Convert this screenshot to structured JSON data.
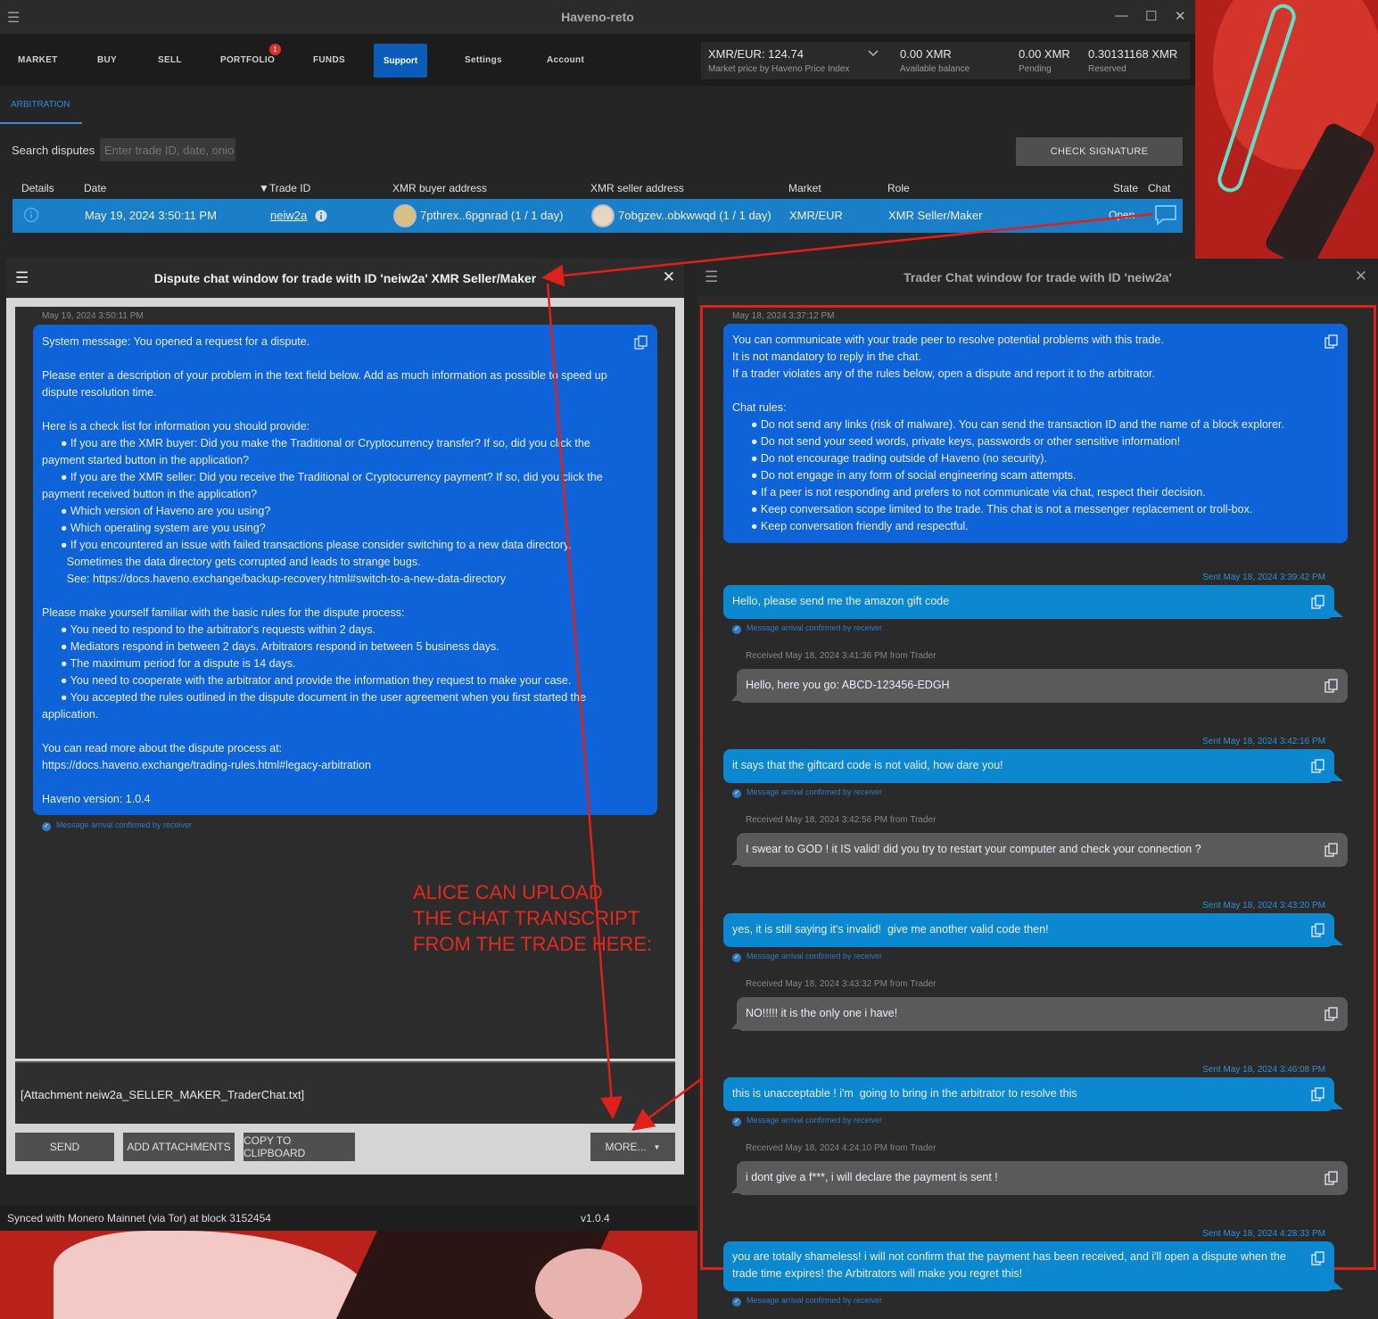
{
  "window": {
    "title": "Haveno-reto",
    "min": "—",
    "max": "☐",
    "close": "✕"
  },
  "nav": {
    "items": [
      "MARKET",
      "BUY",
      "SELL",
      "PORTFOLIO",
      "FUNDS",
      "Support",
      "Settings",
      "Account"
    ],
    "portfolio_badge": "1"
  },
  "balances": {
    "price": "XMR/EUR: 124.74",
    "price_sub": "Market price by Haveno Price Index",
    "available": "0.00 XMR",
    "available_sub": "Available balance",
    "pending": "0.00 XMR",
    "pending_sub": "Pending",
    "reserved": "0.30131168 XMR",
    "reserved_sub": "Reserved"
  },
  "subtab": "ARBITRATION",
  "search": {
    "label": "Search disputes",
    "placeholder": "Enter trade ID, date, onio"
  },
  "check_signature": "CHECK SIGNATURE",
  "table": {
    "headers": [
      "Details",
      "Date",
      "Trade ID",
      "XMR buyer address",
      "XMR seller address",
      "Market",
      "Role",
      "State",
      "Chat"
    ],
    "sort_indicator": "▼",
    "row": {
      "date": "May 19, 2024 3:50:11 PM",
      "trade_id": "neiw2a",
      "buyer": "7pthrex..6pgnrad (1 / 1 day)",
      "seller": "7obgzev..obkwwqd (1 / 1 day)",
      "market": "XMR/EUR",
      "role": "XMR Seller/Maker",
      "state": "Open"
    }
  },
  "dispute": {
    "title": "Dispute chat window for trade with ID 'neiw2a' XMR Seller/Maker",
    "timestamp": "May 19, 2024 3:50:11 PM",
    "message": "System message: You opened a request for a dispute.\n\nPlease enter a description of your problem in the text field below. Add as much information as possible to speed up dispute resolution time.\n\nHere is a check list for information you should provide:\n      ● If you are the XMR buyer: Did you make the Traditional or Cryptocurrency transfer? If so, did you click the payment started button in the application?\n      ● If you are the XMR seller: Did you receive the Traditional or Cryptocurrency payment? If so, did you click the payment received button in the application?\n      ● Which version of Haveno are you using?\n      ● Which operating system are you using?\n      ● If you encountered an issue with failed transactions please consider switching to a new data directory.\n        Sometimes the data directory gets corrupted and leads to strange bugs.\n        See: https://docs.haveno.exchange/backup-recovery.html#switch-to-a-new-data-directory\n\nPlease make yourself familiar with the basic rules for the dispute process:\n      ● You need to respond to the arbitrator's requests within 2 days.\n      ● Mediators respond in between 2 days. Arbitrators respond in between 5 business days.\n      ● The maximum period for a dispute is 14 days.\n      ● You need to cooperate with the arbitrator and provide the information they request to make your case.\n      ● You accepted the rules outlined in the dispute document in the user agreement when you first started the application.\n\nYou can read more about the dispute process at:\nhttps://docs.haveno.exchange/trading-rules.html#legacy-arbitration\n\nHaveno version: 1.0.4",
    "confirmed": "Message arrival confirmed by receiver",
    "input_text": "[Attachment neiw2a_SELLER_MAKER_TraderChat.txt]",
    "buttons": {
      "send": "SEND",
      "attach": "ADD ATTACHMENTS",
      "copy": "COPY TO CLIPBOARD",
      "more": "MORE..."
    }
  },
  "annotation": "ALICE CAN UPLOAD\nTHE CHAT TRANSCRIPT\nFROM THE TRADE HERE:",
  "status": {
    "left": "Synced with Monero Mainnet (via Tor) at block 3152454",
    "right": "v1.0.4"
  },
  "trader": {
    "title": "Trader Chat window for trade with ID 'neiw2a'",
    "system_time": "May 18, 2024 3:37:12 PM",
    "system_msg": "You can communicate with your trade peer to resolve potential problems with this trade.\nIt is not mandatory to reply in the chat.\nIf a trader violates any of the rules below, open a dispute and report it to the arbitrator.\n\nChat rules:\n      ● Do not send any links (risk of malware). You can send the transaction ID and the name of a block explorer.\n      ● Do not send your seed words, private keys, passwords or other sensitive information!\n      ● Do not encourage trading outside of Haveno (no security).\n      ● Do not engage in any form of social engineering scam attempts.\n      ● If a peer is not responding and prefers to not communicate via chat, respect their decision.\n      ● Keep conversation scope limited to the trade. This chat is not a messenger replacement or troll-box.\n      ● Keep conversation friendly and respectful.",
    "confirmed": "Message arrival confirmed by receiver",
    "messages": [
      {
        "kind": "sent",
        "meta": "Sent May 18, 2024 3:39:42 PM",
        "text": "Hello, please send me the amazon gift code"
      },
      {
        "kind": "recv",
        "meta": "Received May 18, 2024 3:41:36 PM from Trader",
        "text": "Hello, here you go: ABCD-123456-EDGH"
      },
      {
        "kind": "sent",
        "meta": "Sent May 18, 2024 3:42:16 PM",
        "text": "it says that the giftcard code is not valid, how dare you!"
      },
      {
        "kind": "recv",
        "meta": "Received May 18, 2024 3:42:56 PM from Trader",
        "text": "I swear to GOD ! it IS valid! did you try to restart your computer and check your connection ?"
      },
      {
        "kind": "sent",
        "meta": "Sent May 18, 2024 3:43:20 PM",
        "text": "yes, it is still saying it's invalid!  give me another valid code then!"
      },
      {
        "kind": "recv",
        "meta": "Received May 18, 2024 3:43:32 PM from Trader",
        "text": "NO!!!!! it is the only one i have!"
      },
      {
        "kind": "sent",
        "meta": "Sent May 18, 2024 3:46:08 PM",
        "text": "this is unacceptable ! i'm  going to bring in the arbitrator to resolve this"
      },
      {
        "kind": "recv",
        "meta": "Received May 18, 2024 4:24:10 PM from Trader",
        "text": "i dont give a f***, i will declare the payment is sent !"
      },
      {
        "kind": "sent",
        "meta": "Sent May 18, 2024 4:28:33 PM",
        "text": "you are totally shameless! i will not confirm that the payment has been received, and i'll open a dispute when the trade time expires! the Arbitrators will make you regret this!"
      }
    ]
  },
  "colors": {
    "accent": "#0b5cb8",
    "selected_row": "#1a7fc8",
    "system_bubble": "#0e63d8",
    "sent_bubble": "#0b88d0",
    "recv_bubble": "#5a5a5a",
    "annotation": "#e32a1f"
  }
}
